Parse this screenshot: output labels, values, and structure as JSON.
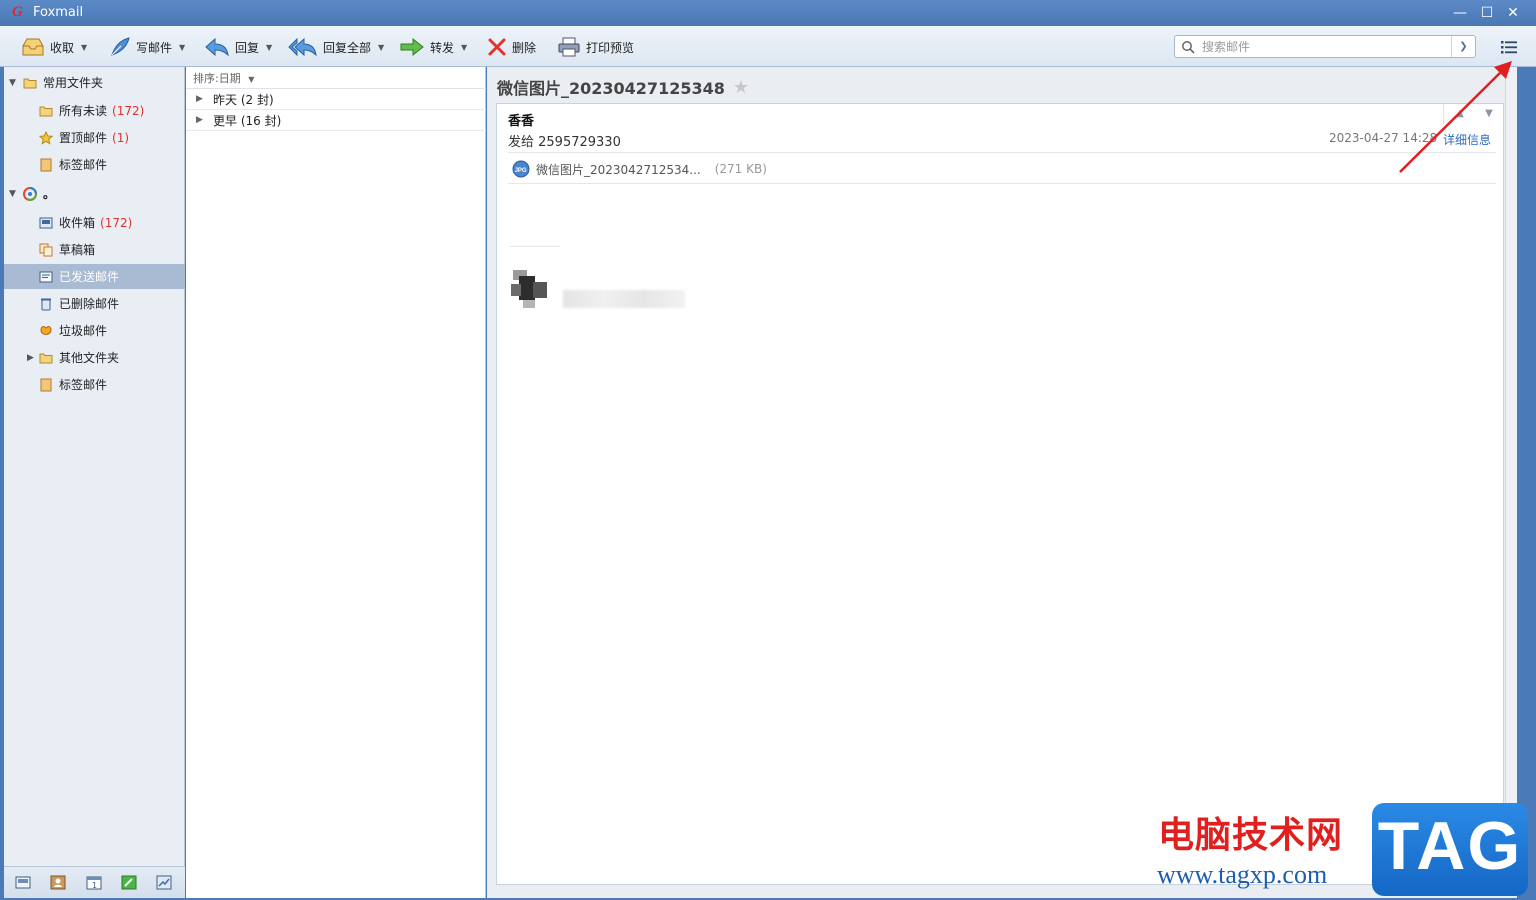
{
  "window": {
    "title": "Foxmail",
    "logo": "G",
    "controls": [
      "—",
      "☐",
      "✕"
    ]
  },
  "toolbar": {
    "receive": "收取",
    "compose": "写邮件",
    "reply": "回复",
    "reply_all": "回复全部",
    "forward": "转发",
    "delete": "删除",
    "print_preview": "打印预览"
  },
  "search": {
    "placeholder": "搜索邮件"
  },
  "sidebar": {
    "groups": [
      {
        "label": "常用文件夹"
      },
      {
        "label": "。"
      }
    ],
    "items": [
      {
        "label": "所有未读",
        "count": "(172)"
      },
      {
        "label": "置顶邮件",
        "count": "(1)"
      },
      {
        "label": "标签邮件",
        "count": ""
      },
      {
        "label": "收件箱",
        "count": "(172)"
      },
      {
        "label": "草稿箱",
        "count": ""
      },
      {
        "label": "已发送邮件",
        "count": ""
      },
      {
        "label": "已删除邮件",
        "count": ""
      },
      {
        "label": "垃圾邮件",
        "count": ""
      },
      {
        "label": "其他文件夹",
        "count": ""
      },
      {
        "label": "标签邮件",
        "count": ""
      }
    ]
  },
  "list": {
    "sort_label": "排序:日期",
    "groups": [
      {
        "label": "昨天 (2 封)"
      },
      {
        "label": "更早 (16 封)"
      }
    ]
  },
  "message": {
    "subject": "微信图片_20230427125348",
    "sender": "香香",
    "to": "发给 2595729330",
    "date": "2023-04-27 14:28",
    "detail_link": "详细信息",
    "attachment_name": "微信图片_2023042712534...",
    "attachment_size": "(271 KB)",
    "attachment_type": "JPG"
  },
  "watermark": {
    "cn": "电脑技术网",
    "url": "www.tagxp.com",
    "tag": "TAG"
  },
  "colors": {
    "titlebar": "#4a78b5",
    "selected_folder": "#a9bbd3",
    "unread_count": "#e0322d",
    "link": "#2e6bbd",
    "annotation_arrow": "#e0201f"
  },
  "icons": {
    "receive": "inbox-tray-icon",
    "compose": "feather-pen-icon",
    "reply": "reply-arrow-icon",
    "reply_all": "reply-all-arrow-icon",
    "forward": "forward-arrow-icon",
    "delete": "red-x-icon",
    "print": "printer-icon",
    "menu": "list-menu-icon"
  }
}
